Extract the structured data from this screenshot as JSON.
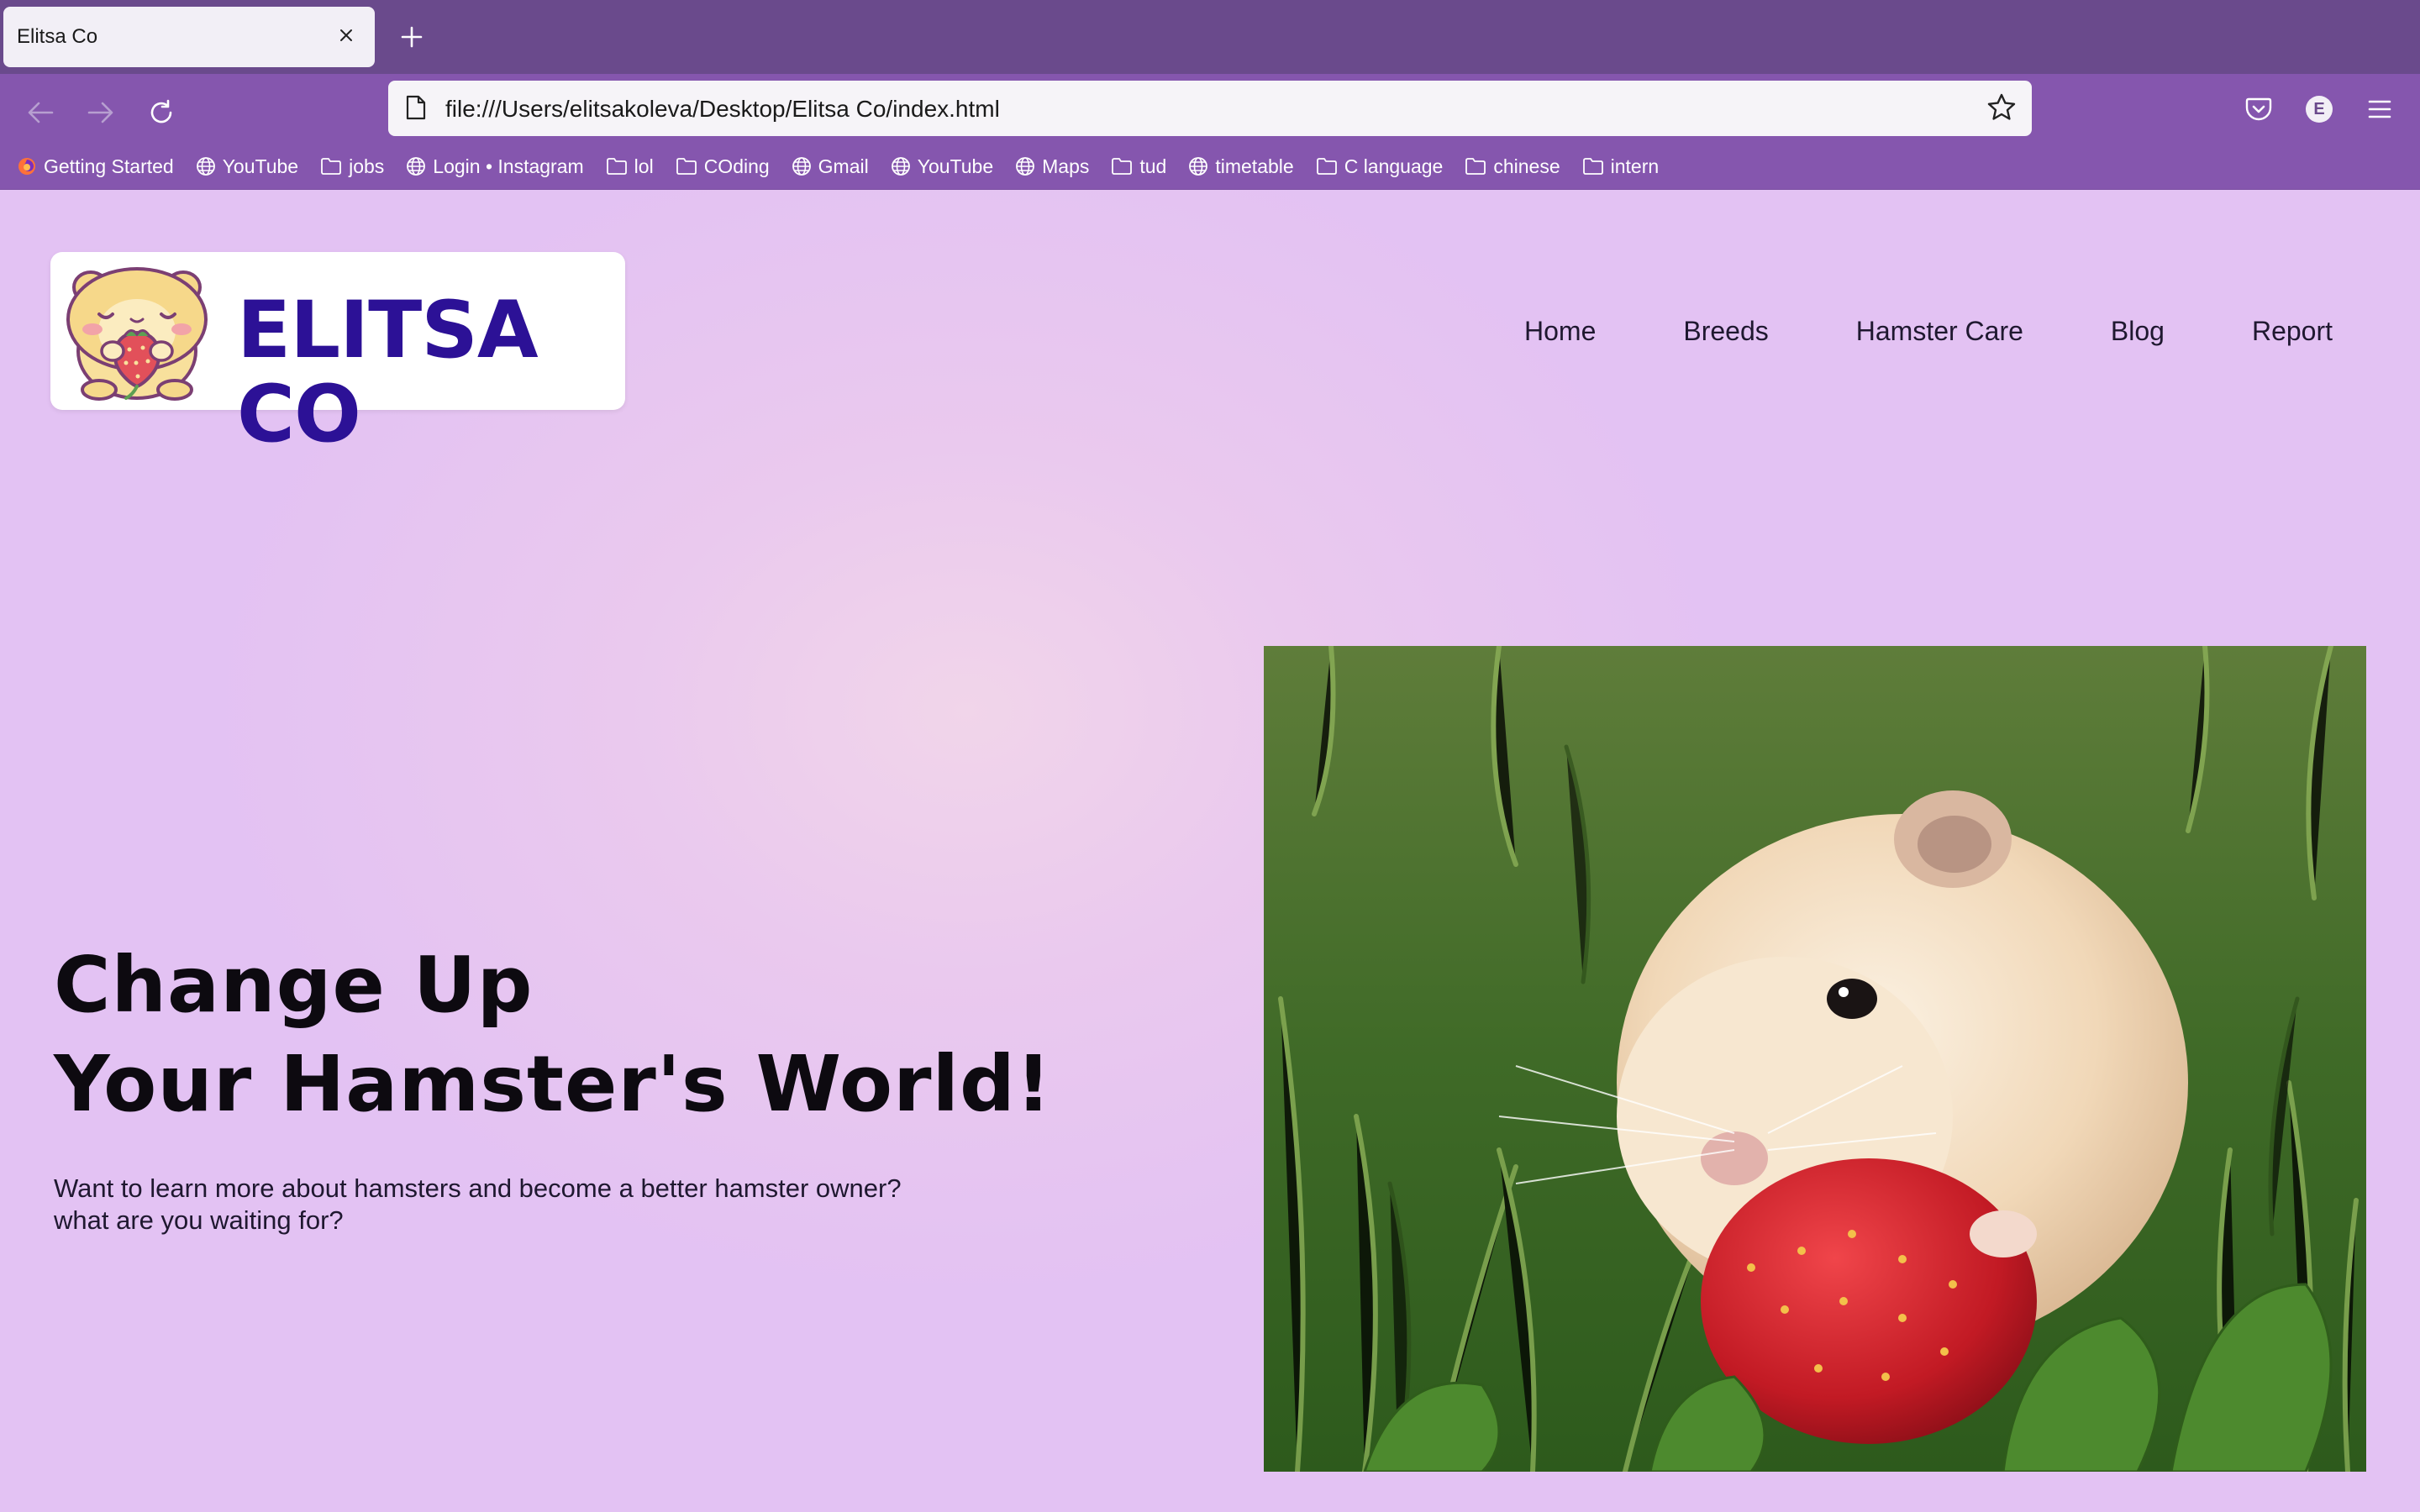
{
  "browser": {
    "tab_title": "Elitsa Co",
    "url": "file:///Users/elitsakoleva/Desktop/Elitsa Co/index.html",
    "account_initial": "E",
    "bookmarks": [
      {
        "label": "Getting Started",
        "icon": "firefox-icon"
      },
      {
        "label": "YouTube",
        "icon": "globe-icon"
      },
      {
        "label": "jobs",
        "icon": "folder-icon"
      },
      {
        "label": "Login • Instagram",
        "icon": "globe-icon"
      },
      {
        "label": "lol",
        "icon": "folder-icon"
      },
      {
        "label": "COding",
        "icon": "folder-icon"
      },
      {
        "label": "Gmail",
        "icon": "globe-icon"
      },
      {
        "label": "YouTube",
        "icon": "globe-icon"
      },
      {
        "label": "Maps",
        "icon": "globe-icon"
      },
      {
        "label": "tud",
        "icon": "folder-icon"
      },
      {
        "label": "timetable",
        "icon": "globe-icon"
      },
      {
        "label": "C language",
        "icon": "folder-icon"
      },
      {
        "label": "chinese",
        "icon": "folder-icon"
      },
      {
        "label": "intern",
        "icon": "folder-icon"
      }
    ]
  },
  "site": {
    "logo_text": "ELITSA CO",
    "nav": [
      "Home",
      "Breeds",
      "Hamster Care",
      "Blog",
      "Report"
    ],
    "hero": {
      "title_line1": "Change Up",
      "title_line2": "Your Hamster's World!",
      "subtitle_line1": "Want to learn more about hamsters and become a better hamster owner?",
      "subtitle_line2": "what are you waiting for?"
    }
  },
  "colors": {
    "tab_strip": "#6a4a8c",
    "toolbar": "#8556ae",
    "page_background": "#e6c3f0",
    "logo_text": "#2c1196",
    "heading": "#0d0a10"
  }
}
